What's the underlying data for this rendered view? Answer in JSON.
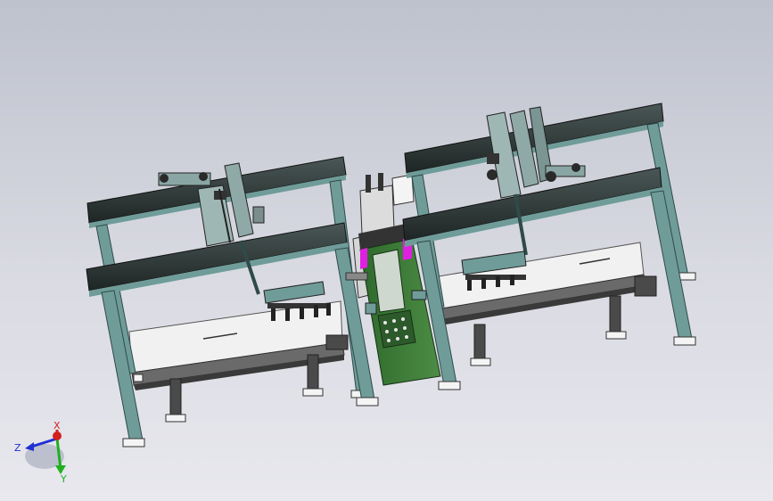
{
  "viewport": {
    "background_top": "#bec2cd",
    "background_bottom": "#e8e8ee"
  },
  "colors": {
    "frame_teal": "#6f9c99",
    "frame_dark": "#2f4a49",
    "beam_dark": "#27302f",
    "bed_white": "#f1f1f1",
    "cabinet_green": "#3f7a3a",
    "accent_magenta": "#e020e0",
    "foot_white": "#f4f4f4"
  },
  "triad": {
    "x_label": "X",
    "y_label": "Y",
    "z_label": "Z",
    "x_color": "#d22020",
    "y_color": "#20b020",
    "z_color": "#2030d0"
  },
  "icons": [
    "coordinate-triad-icon"
  ]
}
